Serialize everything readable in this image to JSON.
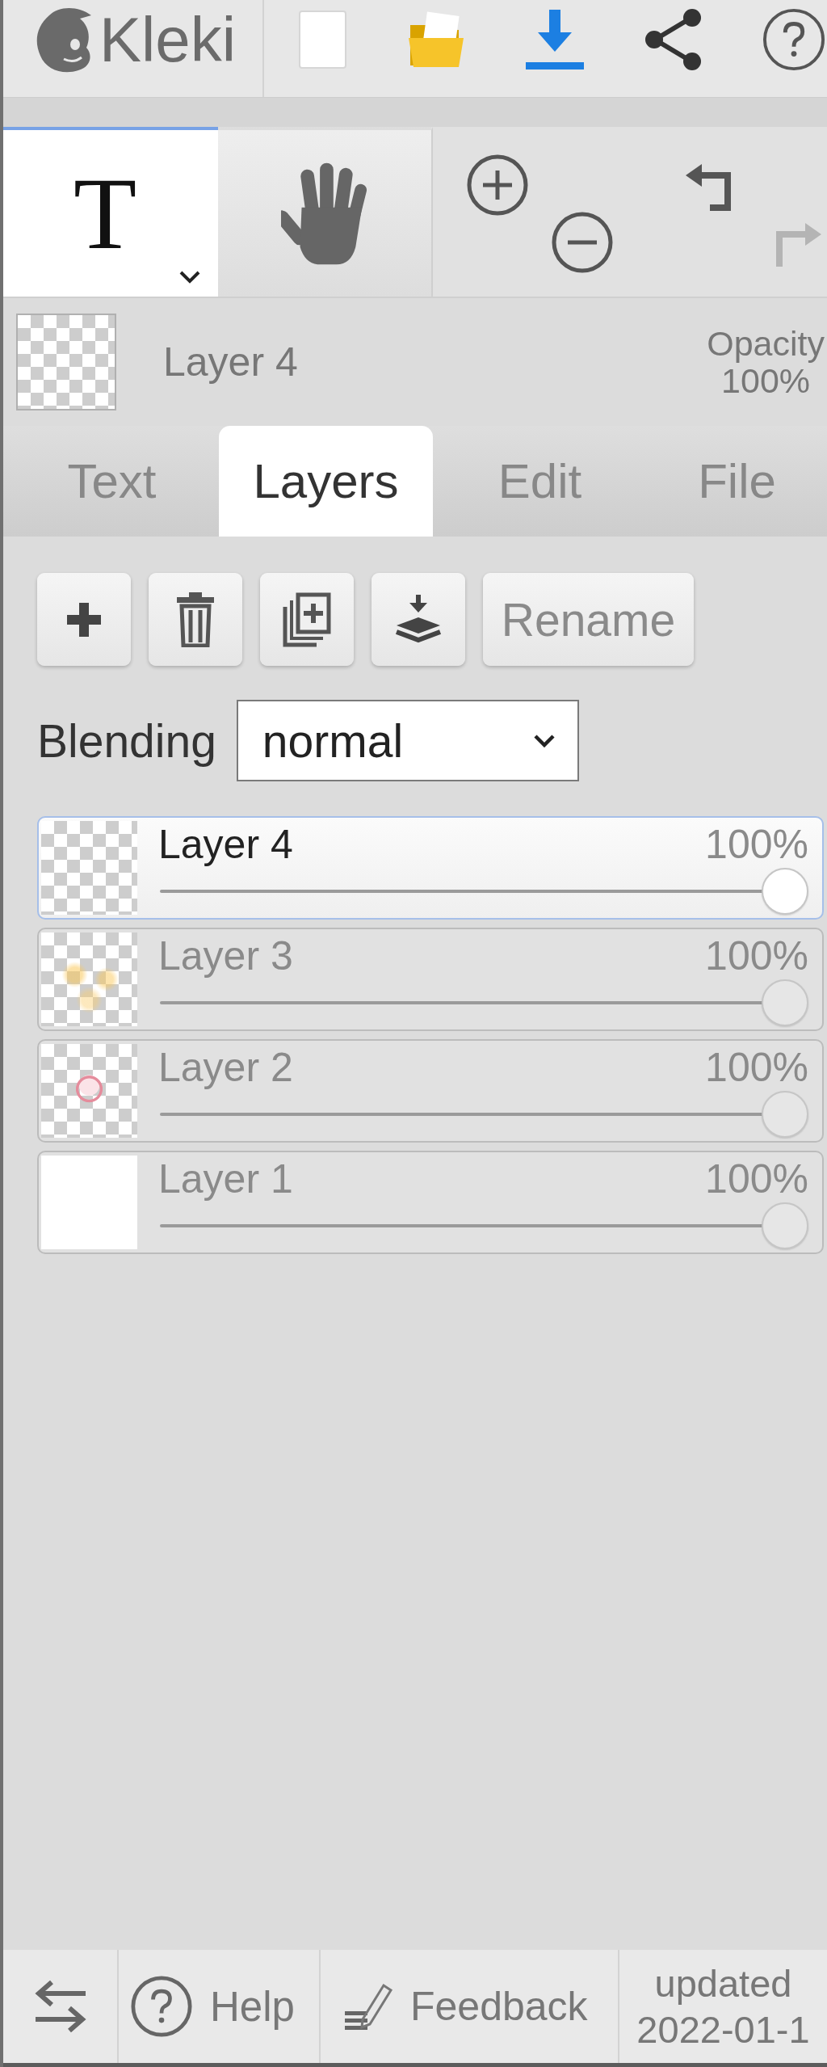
{
  "top_bar": {
    "logo": "Kleki",
    "actions": [
      {
        "kind": "new"
      },
      {
        "kind": "open"
      },
      {
        "kind": "save"
      },
      {
        "kind": "share"
      },
      {
        "kind": "help"
      }
    ]
  },
  "tools": [
    {
      "kind": "text",
      "glyph": "T",
      "selected": true
    },
    {
      "kind": "hand",
      "selected": false
    }
  ],
  "view_controls": [
    {
      "kind": "zoom_in",
      "disabled": false
    },
    {
      "kind": "zoom_out",
      "disabled": false
    },
    {
      "kind": "undo",
      "disabled": false
    },
    {
      "kind": "redo",
      "disabled": true
    }
  ],
  "current_layer": {
    "name": "Layer 4",
    "opacity_label": "Opacity",
    "opacity": "100%"
  },
  "tabs": [
    {
      "label": "Text",
      "selected": false
    },
    {
      "label": "Layers",
      "selected": true
    },
    {
      "label": "Edit",
      "selected": false
    },
    {
      "label": "File",
      "selected": false
    }
  ],
  "layer_actions": [
    {
      "kind": "add"
    },
    {
      "kind": "delete"
    },
    {
      "kind": "duplicate"
    },
    {
      "kind": "merge"
    },
    {
      "kind": "rename",
      "label": "Rename"
    }
  ],
  "blending": {
    "label": "Blending",
    "value": "normal"
  },
  "layers": [
    {
      "kind": "transparent",
      "name": "Layer 4",
      "opacity": "100%",
      "level": 1,
      "selected": true
    },
    {
      "kind": "smudge",
      "name": "Layer 3",
      "opacity": "100%",
      "level": 1,
      "selected": false
    },
    {
      "kind": "doodle",
      "name": "Layer 2",
      "opacity": "100%",
      "level": 1,
      "selected": false
    },
    {
      "kind": "white",
      "name": "Layer 1",
      "opacity": "100%",
      "level": 1,
      "selected": false
    }
  ],
  "bottom_bar": {
    "items": [
      {
        "kind": "swap"
      },
      {
        "kind": "help",
        "label": "Help"
      },
      {
        "kind": "feedback",
        "label": "Feedback"
      }
    ],
    "version": [
      "updated",
      "2022-01-1"
    ]
  }
}
